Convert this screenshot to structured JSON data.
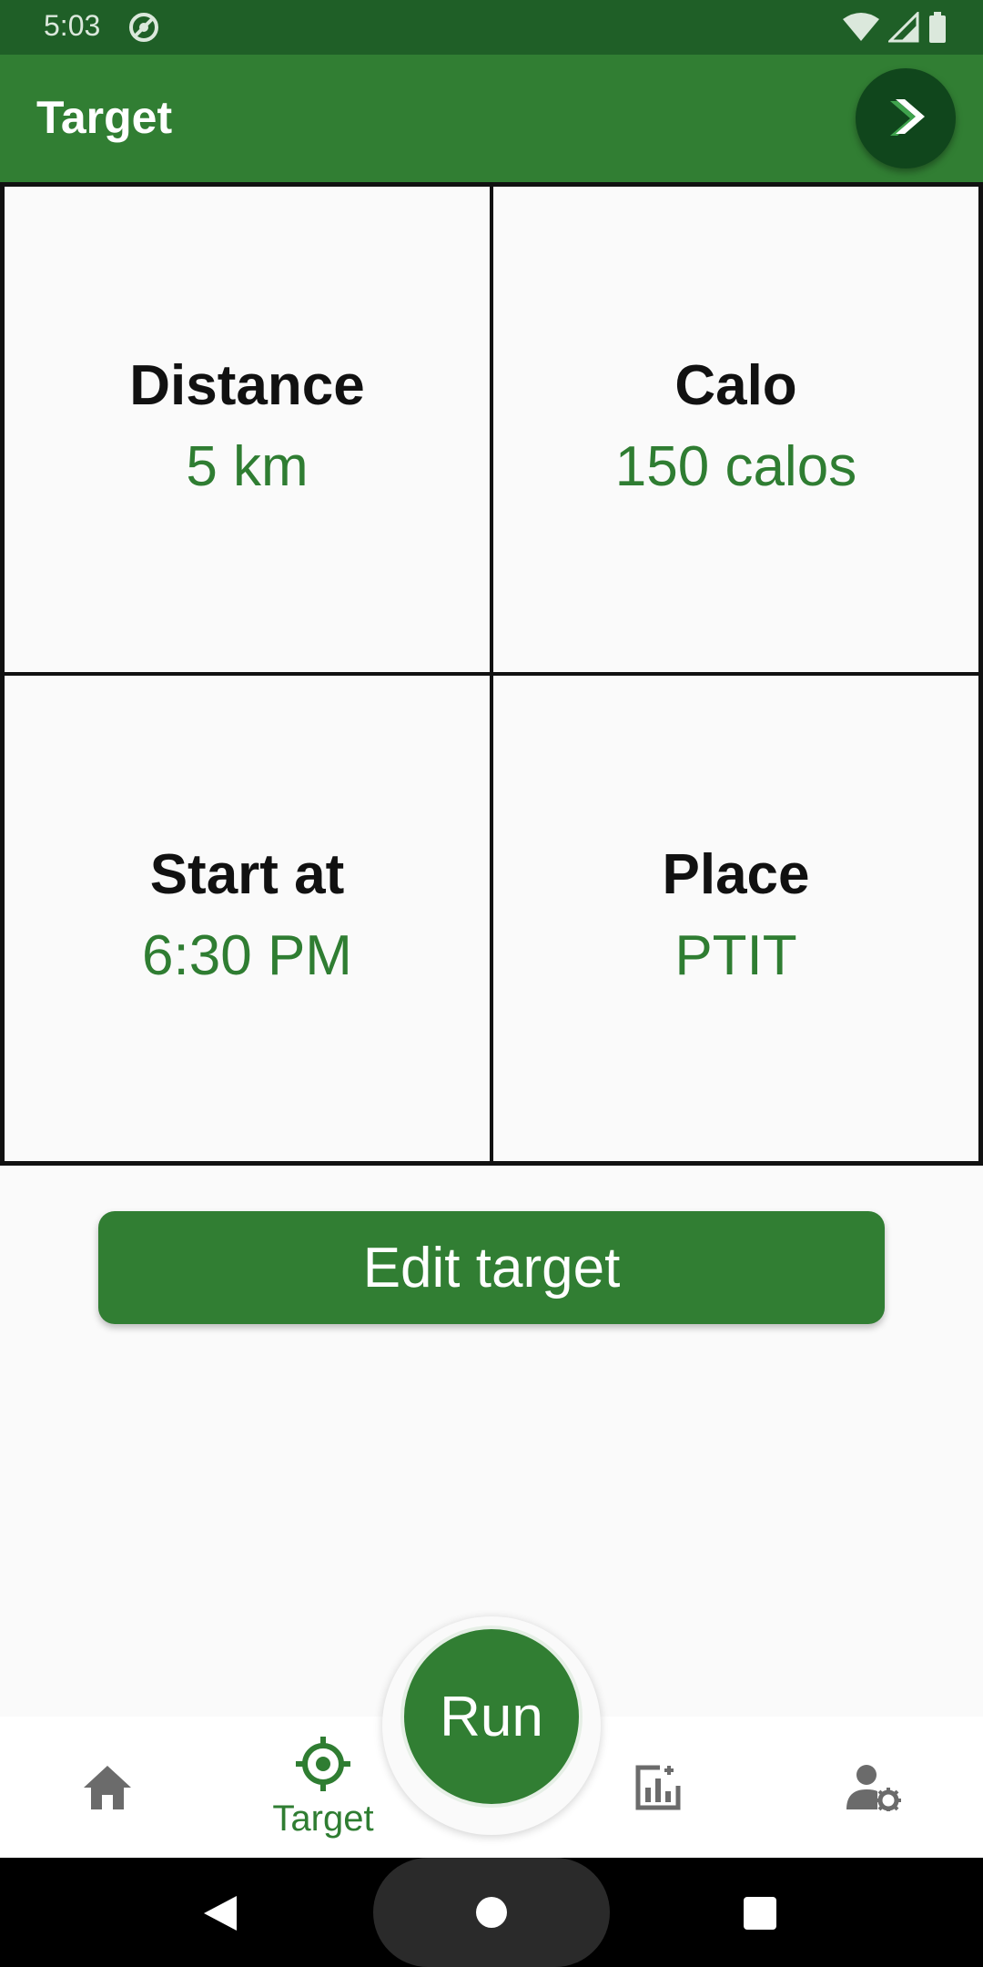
{
  "status_bar": {
    "time": "5:03"
  },
  "app_bar": {
    "title": "Target"
  },
  "targets": [
    {
      "label": "Distance",
      "value": "5 km"
    },
    {
      "label": "Calo",
      "value": "150 calos"
    },
    {
      "label": "Start at",
      "value": "6:30 PM"
    },
    {
      "label": "Place",
      "value": "PTIT"
    }
  ],
  "edit_button": {
    "label": "Edit target"
  },
  "bottom_nav": {
    "items": [
      {
        "icon": "home-icon",
        "label": ""
      },
      {
        "icon": "target-icon",
        "label": "Target"
      },
      {
        "icon": "stats-icon",
        "label": ""
      },
      {
        "icon": "user-settings-icon",
        "label": ""
      }
    ],
    "run_label": "Run"
  },
  "colors": {
    "primary": "#317e33",
    "primary_dark": "#1f5f27",
    "value_text": "#2f7d32",
    "fab": "#10461c"
  }
}
